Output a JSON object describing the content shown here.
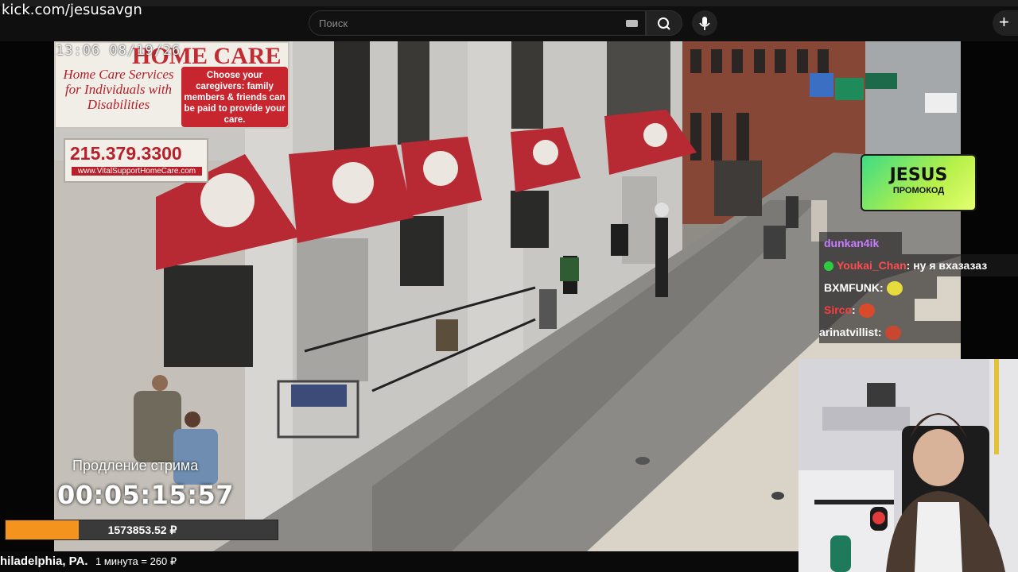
{
  "browser": {
    "url_overlay": "kick.com/jesusavgn",
    "search": {
      "placeholder": "Поиск"
    }
  },
  "video": {
    "timestamp": "13:06 08/19/26",
    "sign": {
      "heading": "HOME CARE",
      "left_text": "Home Care Services for Individuals with Disabilities",
      "right_text": "Choose your caregivers: family members & friends can be paid to provide your care.",
      "phone": "215.379.3300",
      "url": "www.VitalSupportHomeCare.com"
    }
  },
  "promo": {
    "title": "JESUS",
    "subtitle": "ПРОМОКОД"
  },
  "chat": [
    {
      "user": "dunkan4ik",
      "color": "#c77dff",
      "message": "",
      "emote": ""
    },
    {
      "user": "Youkai_Chan",
      "color": "#ff4d4d",
      "message": ": ну я вхазазаз",
      "emote": "",
      "badge": "check"
    },
    {
      "user": "BXMFUNK",
      "color": "#ffffff",
      "message": ":",
      "emote": "yellow"
    },
    {
      "user": "Sirco",
      "color": "#ff3b3b",
      "message": ":",
      "emote": "red"
    },
    {
      "user": "arinatvillist",
      "color": "#ffffff",
      "message": ":",
      "emote": "red"
    }
  ],
  "stream": {
    "extend_label": "Продление стрима",
    "timer": "00:05:15:57",
    "progress_amount": "1573853.52 ₽",
    "progress_fraction": 0.27,
    "location": "hiladelphia, PA.",
    "rate": "1 минута = 260 ₽"
  },
  "colors": {
    "accent": "#f5931f",
    "promo": "#7ee35a",
    "awning": "#b82a33"
  }
}
